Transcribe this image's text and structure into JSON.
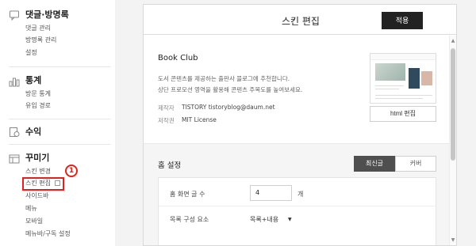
{
  "sidebar": {
    "sections": [
      {
        "title": "댓글·방명록",
        "icon": "comment-icon",
        "items": [
          "댓글 관리",
          "방명록 관리",
          "설정"
        ]
      },
      {
        "title": "통계",
        "icon": "bar-chart-icon",
        "items": [
          "방문 통계",
          "유입 경로"
        ]
      },
      {
        "title": "수익",
        "icon": "revenue-icon",
        "items": []
      },
      {
        "title": "꾸미기",
        "icon": "layout-icon",
        "items": [
          "스킨 변경",
          "스킨 편집",
          "사이드바",
          "메뉴",
          "모바일",
          "메뉴바/구독 설정"
        ]
      }
    ],
    "highlight_badge": "1",
    "highlight_color": "#e0221b"
  },
  "panel": {
    "title": "스킨 편집",
    "apply_label": "적용",
    "skin_name": "Book Club",
    "description": [
      "도서 콘텐츠를 제공하는 출판사 블로그에 추천합니다.",
      "상단 프로모션 영역을 활용해 콘텐츠 주목도를 높여보세요."
    ],
    "meta": [
      {
        "label": "제작자",
        "value": "TISTORY  tistoryblog@daum.net"
      },
      {
        "label": "저작권",
        "value": "MIT License"
      }
    ],
    "html_edit_label": "html 편집"
  },
  "home": {
    "title": "홈 설정",
    "tabs": [
      "최신글",
      "커버"
    ],
    "active_tab": 0,
    "post_count_label": "홈 화면 글 수",
    "post_count_value": "4",
    "post_count_unit": "개",
    "list_config_label": "목록 구성 요소",
    "list_config_value": "목록+내용"
  }
}
